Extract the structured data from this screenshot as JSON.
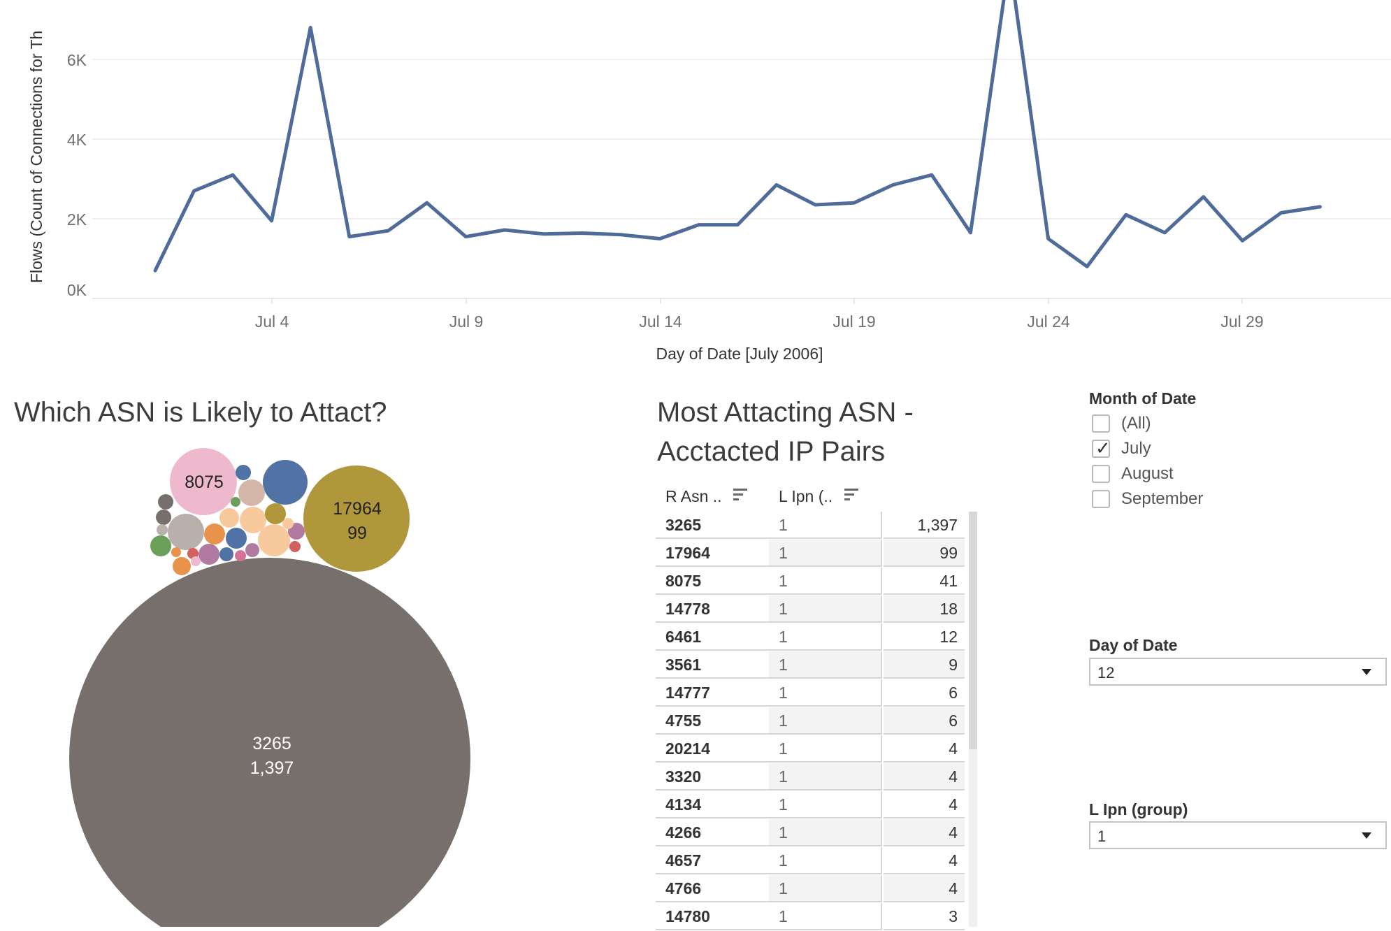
{
  "line_chart": {
    "ylabel": "Flows (Count of Connections for Th",
    "xlabel": "Day of Date [July 2006]",
    "y_ticks": [
      "6K",
      "4K",
      "2K",
      "0K"
    ],
    "x_ticks": [
      "Jul 4",
      "Jul 9",
      "Jul 14",
      "Jul 19",
      "Jul 24",
      "Jul 29"
    ]
  },
  "chart_data": {
    "type": "line",
    "xlabel": "Day of Date [July 2006]",
    "ylabel": "Flows (Count of Connections for Th",
    "x": [
      "Jul 2",
      "Jul 3",
      "Jul 4",
      "Jul 5",
      "Jul 6",
      "Jul 7",
      "Jul 8",
      "Jul 9",
      "Jul 10",
      "Jul 11",
      "Jul 12",
      "Jul 13",
      "Jul 14",
      "Jul 15",
      "Jul 16",
      "Jul 17",
      "Jul 18",
      "Jul 19",
      "Jul 20",
      "Jul 21",
      "Jul 22",
      "Jul 23",
      "Jul 24",
      "Jul 25",
      "Jul 26",
      "Jul 27",
      "Jul 28",
      "Jul 29",
      "Jul 30",
      "Jul 31",
      "Aug 1"
    ],
    "y": [
      700,
      2700,
      3100,
      1950,
      6800,
      1550,
      1700,
      2400,
      1550,
      1720,
      1620,
      1640,
      1600,
      1500,
      1850,
      1850,
      2850,
      2350,
      2400,
      2850,
      3100,
      1650,
      8500,
      1500,
      800,
      2100,
      1650,
      2550,
      1450,
      2150,
      2300
    ],
    "ylim": [
      0,
      7500
    ],
    "grid": true,
    "color": "#4e6b99"
  },
  "bubble": {
    "title": "Which ASN is Likely to Attact?",
    "big_asn": "3265",
    "big_value": "1,397",
    "olive_asn": "17964",
    "olive_value": "99",
    "pink_asn": "8075",
    "colors": {
      "big": "#776f6c",
      "olive": "#b0973c",
      "pink": "#efb9cd",
      "blue": "#5172a5"
    }
  },
  "table": {
    "title_line1": "Most Attacting ASN -",
    "title_line2": "Acctacted IP Pairs",
    "col1_header": "R Asn ..",
    "col2_header": "L Ipn (..",
    "rows": [
      {
        "asn": "3265",
        "ipn": "1",
        "count": "1,397"
      },
      {
        "asn": "17964",
        "ipn": "1",
        "count": "99"
      },
      {
        "asn": "8075",
        "ipn": "1",
        "count": "41"
      },
      {
        "asn": "14778",
        "ipn": "1",
        "count": "18"
      },
      {
        "asn": "6461",
        "ipn": "1",
        "count": "12"
      },
      {
        "asn": "3561",
        "ipn": "1",
        "count": "9"
      },
      {
        "asn": "14777",
        "ipn": "1",
        "count": "6"
      },
      {
        "asn": "4755",
        "ipn": "1",
        "count": "6"
      },
      {
        "asn": "20214",
        "ipn": "1",
        "count": "4"
      },
      {
        "asn": "3320",
        "ipn": "1",
        "count": "4"
      },
      {
        "asn": "4134",
        "ipn": "1",
        "count": "4"
      },
      {
        "asn": "4266",
        "ipn": "1",
        "count": "4"
      },
      {
        "asn": "4657",
        "ipn": "1",
        "count": "4"
      },
      {
        "asn": "4766",
        "ipn": "1",
        "count": "4"
      },
      {
        "asn": "14780",
        "ipn": "1",
        "count": "3"
      }
    ]
  },
  "filters": {
    "month": {
      "title": "Month of Date",
      "options": [
        {
          "label": "(All)",
          "checked": false
        },
        {
          "label": "July",
          "checked": true
        },
        {
          "label": "August",
          "checked": false
        },
        {
          "label": "September",
          "checked": false
        }
      ],
      "check_glyph": "✓"
    },
    "day": {
      "title": "Day of Date",
      "value": "12"
    },
    "lipn": {
      "title": "L Ipn (group)",
      "value": "1"
    }
  }
}
